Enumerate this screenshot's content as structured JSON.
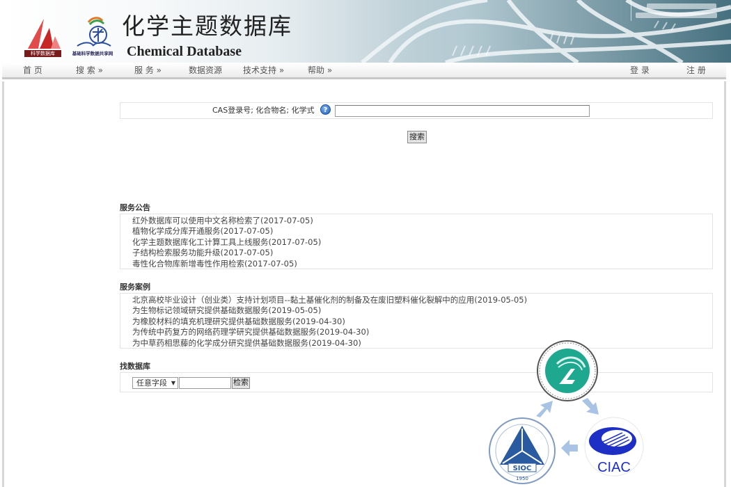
{
  "header": {
    "title_cn": "化学主题数据库",
    "title_en": "Chemical Database",
    "logo1_label": "科学数据库",
    "logo2_label": "基础科学数据共享网"
  },
  "nav": {
    "items": [
      {
        "label": "首 页"
      },
      {
        "label": "搜 索 »"
      },
      {
        "label": "服 务 »"
      },
      {
        "label": "数据资源"
      },
      {
        "label": "技术支持 »"
      },
      {
        "label": "帮助 »"
      }
    ],
    "login": "登 录",
    "register": "注 册"
  },
  "search": {
    "label": "CAS登录号; 化合物名; 化学式",
    "help_icon": "?",
    "input_value": "",
    "button_label": "搜索"
  },
  "announcements": {
    "title": "服务公告",
    "items": [
      "红外数据库可以使用中文名称检索了(2017-07-05)",
      "植物化学成分库开通服务(2017-07-05)",
      "化学主题数据库化工计算工具上线服务(2017-07-05)",
      "子结构检索服务功能升级(2017-07-05)",
      "毒性化合物库新增毒性作用检索(2017-07-05)"
    ]
  },
  "cases": {
    "title": "服务案例",
    "items": [
      "北京高校毕业设计（创业类）支持计划项目--黏土基催化剂的制备及在废旧塑料催化裂解中的应用(2019-05-05)",
      "为生物标记领域研究提供基础数据服务(2019-05-05)",
      "为橡胶材料的填充机理研究提供基础数据服务(2019-04-30)",
      "为传统中药复方的网络药理学研究提供基础数据服务(2019-04-30)",
      "为中草药相思藤的化学成分研究提供基础数据服务(2019-04-30)"
    ]
  },
  "find_db": {
    "title": "找数据库",
    "select_value": "任意字段",
    "input_value": "",
    "button_label": "检索"
  },
  "partners": {
    "siioc_label": "SIOC",
    "siioc_year": "1950",
    "ciac_label": "CIAC"
  },
  "colors": {
    "accent_blue": "#1e5fb8",
    "teal_logo": "#1fa890",
    "siioc_blue": "#2a5aa0",
    "arrow": "#a9c3e4"
  }
}
